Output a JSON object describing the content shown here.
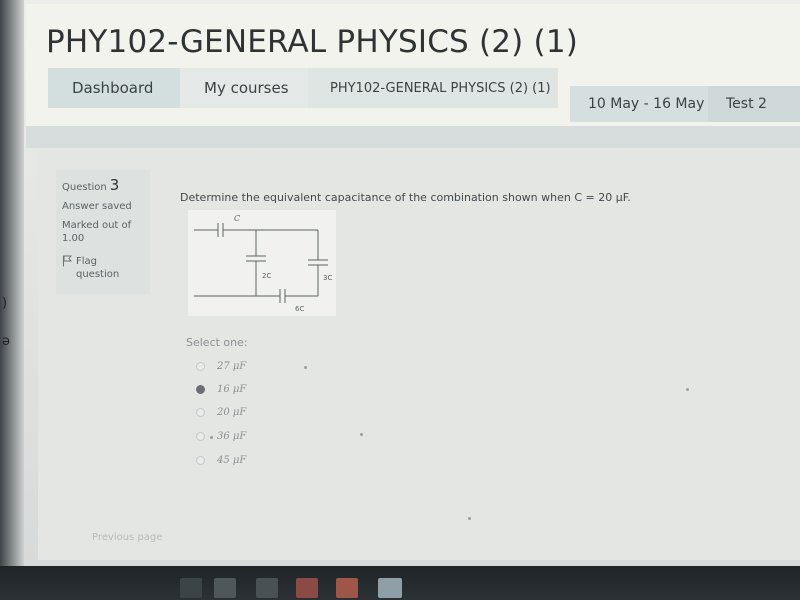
{
  "page": {
    "title": "PHY102-GENERAL PHYSICS (2) (1)"
  },
  "breadcrumb": {
    "items": [
      {
        "label": "Dashboard"
      },
      {
        "label": "My courses"
      },
      {
        "label": "PHY102-GENERAL PHYSICS (2) (1)"
      },
      {
        "label": "10 May - 16 May"
      },
      {
        "label": "Test 2"
      }
    ]
  },
  "question_info": {
    "question_label": "Question",
    "question_number": "3",
    "status": "Answer saved",
    "marked_out_of": "Marked out of",
    "mark_value": "1.00",
    "flag_label": "Flag",
    "flag_label_2": "question"
  },
  "question": {
    "text": "Determine the equivalent capacitance of the combination shown when C = 20 μF.",
    "select_one": "Select one:",
    "options": [
      {
        "label": "27 μF",
        "selected": false
      },
      {
        "label": "16 μF",
        "selected": true
      },
      {
        "label": "20 μF",
        "selected": false
      },
      {
        "label": "36 μF",
        "selected": false
      },
      {
        "label": "45 μF",
        "selected": false
      }
    ]
  },
  "circuit": {
    "label_top": "C",
    "label_left": "2C",
    "label_right": "3C",
    "label_bottom": "6C"
  },
  "navigation": {
    "previous_page": "Previous page"
  },
  "colors": {
    "breadcrumb_active": "#d3dedf",
    "selected_radio": "#6a7072"
  }
}
